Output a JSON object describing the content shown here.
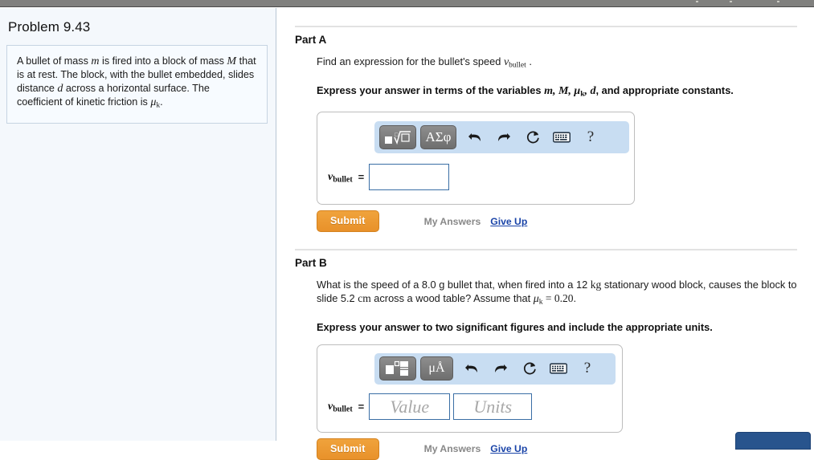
{
  "topbar": {
    "ticks": [
      866,
      908,
      967
    ]
  },
  "sidebar": {
    "problem_title": "Problem 9.43",
    "problem_text_parts": {
      "p1": "A bullet of mass ",
      "m": "m",
      "p2": " is fired into a block of mass ",
      "M": "M",
      "p3": " that is at rest. The block, with the bullet embedded, slides distance ",
      "d": "d",
      "p4": " across a horizontal surface. The coefficient of kinetic friction is ",
      "mu": "μ",
      "mu_sub": "k",
      "p5": "."
    }
  },
  "parts": {
    "a": {
      "title": "Part A",
      "prompt_pre": "Find an expression for the bullet's speed ",
      "prompt_var": "v",
      "prompt_var_sub": "bullet",
      "prompt_post": " .",
      "instruction_pre": "Express your answer in terms of the variables ",
      "instruction_vars": "m, M, μ",
      "instruction_vars_sub": "k",
      "instruction_vars2": ", d",
      "instruction_post": ", and appropriate constants.",
      "toolbar": {
        "template_button": "template-radical",
        "greek_button": "ΑΣφ",
        "undo": "undo-arrow",
        "redo": "redo-arrow",
        "reset": "reset-arrow",
        "keyboard": "keyboard-icon",
        "help": "?"
      },
      "answer_label_var": "v",
      "answer_label_sub": "bullet",
      "answer_equals": "=",
      "answer_value": "",
      "submit_label": "Submit",
      "my_answers_label": "My Answers",
      "give_up_label": "Give Up"
    },
    "b": {
      "title": "Part B",
      "prompt_pre": "What is the speed of a 8.0 g bullet that, when fired into a 12 ",
      "prompt_kg": "kg",
      "prompt_mid": " stationary wood block, causes the block to slide 5.2 ",
      "prompt_cm": "cm",
      "prompt_mid2": " across a wood table? Assume that ",
      "prompt_mu": "μ",
      "prompt_mu_sub": "k",
      "prompt_eq": " = 0.20",
      "prompt_post": ".",
      "instruction": "Express your answer to two significant figures and include the appropriate units.",
      "toolbar": {
        "template_button": "template-blocks",
        "units_button": "μÅ",
        "undo": "undo-arrow",
        "redo": "redo-arrow",
        "reset": "reset-arrow",
        "keyboard": "keyboard-icon",
        "help": "?"
      },
      "answer_label_var": "v",
      "answer_label_sub": "bullet",
      "answer_equals": "=",
      "value_placeholder": "Value",
      "units_placeholder": "Units",
      "value_text": "",
      "units_text": "",
      "submit_label": "Submit",
      "my_answers_label": "My Answers",
      "give_up_label": "Give Up"
    }
  },
  "colors": {
    "accent_orange": "#e8912a",
    "link_blue": "#1a44a8",
    "toolbar_blue": "#c8ddf2",
    "sidebar_bg": "#f4f8fc",
    "blue_button": "#28548d"
  }
}
